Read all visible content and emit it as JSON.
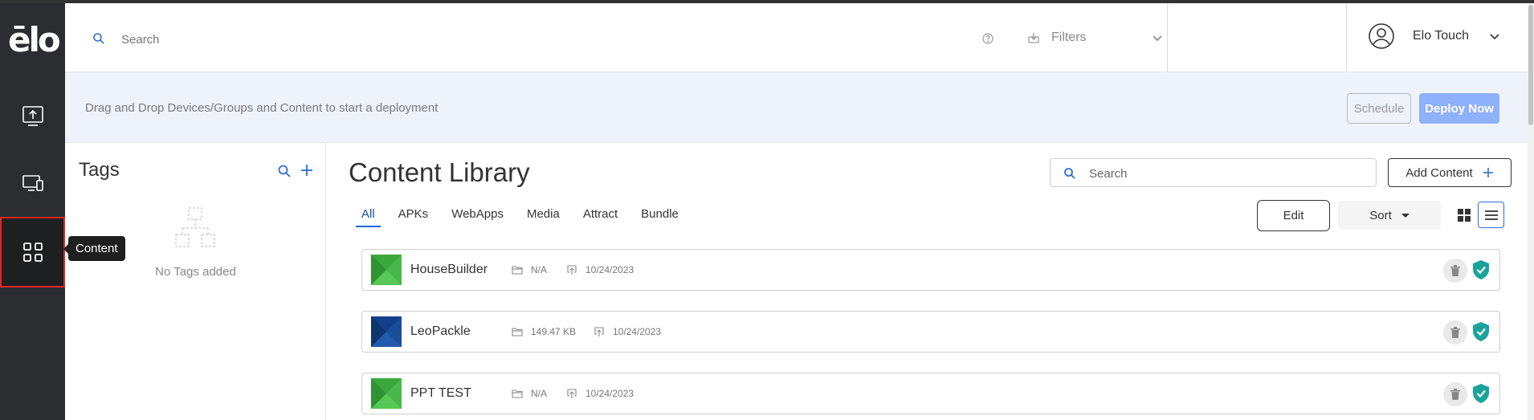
{
  "brand": {
    "logo_text": "ēlo"
  },
  "rail": {
    "tooltip": "Content"
  },
  "topbar": {
    "search_placeholder": "Search",
    "filters_label": "Filters",
    "user_name": "Elo Touch"
  },
  "banner": {
    "text": "Drag and Drop Devices/Groups and Content to start a deployment",
    "schedule_label": "Schedule",
    "deploy_label": "Deploy Now"
  },
  "tags": {
    "title": "Tags",
    "empty_text": "No Tags added"
  },
  "library": {
    "title": "Content Library",
    "search_placeholder": "Search",
    "add_label": "Add Content",
    "edit_label": "Edit",
    "sort_label": "Sort",
    "tabs": [
      {
        "label": "All",
        "active": true
      },
      {
        "label": "APKs"
      },
      {
        "label": "WebApps"
      },
      {
        "label": "Media"
      },
      {
        "label": "Attract"
      },
      {
        "label": "Bundle"
      }
    ],
    "items": [
      {
        "name": "HouseBuilder",
        "size": "N/A",
        "date": "10/24/2023",
        "thumb_color": "#3aa83c"
      },
      {
        "name": "LeoPackle",
        "size": "149.47 KB",
        "date": "10/24/2023",
        "thumb_color": "#13408a"
      },
      {
        "name": "PPT TEST",
        "size": "N/A",
        "date": "10/24/2023",
        "thumb_color": "#3aa83c"
      }
    ]
  },
  "colors": {
    "rail_bg": "#2b2d30",
    "accent_blue": "#1a66e0",
    "deploy_button": "#8fb0fb",
    "banner_bg": "#eef2fb",
    "shield_teal": "#1aa39a",
    "active_outline": "#e2261c"
  }
}
